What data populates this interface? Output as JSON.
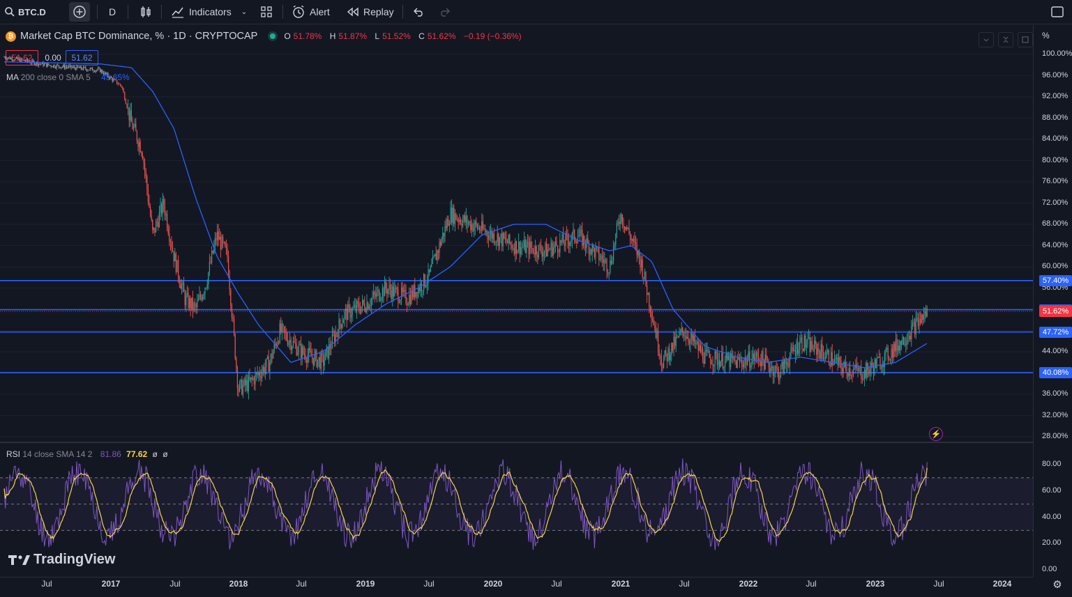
{
  "toolbar": {
    "symbol": "BTC.D",
    "interval": "D",
    "indicators_label": "Indicators",
    "alert_label": "Alert",
    "replay_label": "Replay",
    "icons": [
      "search-icon",
      "add-symbol-icon",
      "candles-icon",
      "indicators-icon",
      "templates-icon",
      "alert-icon",
      "replay-icon",
      "undo-icon",
      "redo-icon",
      "fullscreen-icon"
    ]
  },
  "legend": {
    "title": "Market Cap BTC Dominance, % · 1D · CRYPTOCAP",
    "o_label": "O",
    "o_value": "51.78%",
    "h_label": "H",
    "h_value": "51.87%",
    "l_label": "L",
    "l_value": "51.52%",
    "c_label": "C",
    "c_value": "51.62%",
    "change": "−0.19 (−0.36%)",
    "bid": "51.62",
    "spread": "0.00",
    "ask": "51.62"
  },
  "ma_legend": {
    "name": "MA",
    "params": "200 close 0 SMA 5",
    "value": "45.65%"
  },
  "rsi_legend": {
    "name": "RSI",
    "params": "14 close SMA 14 2",
    "rsi_value": "81.86",
    "ma_value": "77.62",
    "extra1": "ø",
    "extra2": "ø"
  },
  "watermark": "TradingView",
  "price_axis": {
    "unit": "%",
    "ticks": [
      "100.00%",
      "96.00%",
      "92.00%",
      "88.00%",
      "84.00%",
      "80.00%",
      "76.00%",
      "72.00%",
      "68.00%",
      "64.00%",
      "60.00%",
      "56.00%",
      "44.00%",
      "36.00%",
      "32.00%",
      "28.00%"
    ],
    "labels": [
      {
        "text": "57.40%",
        "value": 57.4,
        "color": "#2962ff"
      },
      {
        "text": "51.92%",
        "value": 51.92,
        "color": "#2962ff"
      },
      {
        "text": "51.62%",
        "value": 51.62,
        "color": "#f23645"
      },
      {
        "text": "47.72%",
        "value": 47.72,
        "color": "#2962ff"
      },
      {
        "text": "40.08%",
        "value": 40.08,
        "color": "#2962ff"
      }
    ]
  },
  "rsi_axis": {
    "ticks": [
      "80.00",
      "60.00",
      "40.00",
      "20.00",
      "0.00"
    ]
  },
  "time_axis": [
    {
      "label": "Jul",
      "bold": false
    },
    {
      "label": "2017",
      "bold": true
    },
    {
      "label": "Jul",
      "bold": false
    },
    {
      "label": "2018",
      "bold": true
    },
    {
      "label": "Jul",
      "bold": false
    },
    {
      "label": "2019",
      "bold": true
    },
    {
      "label": "Jul",
      "bold": false
    },
    {
      "label": "2020",
      "bold": true
    },
    {
      "label": "Jul",
      "bold": false
    },
    {
      "label": "2021",
      "bold": true
    },
    {
      "label": "Jul",
      "bold": false
    },
    {
      "label": "2022",
      "bold": true
    },
    {
      "label": "Jul",
      "bold": false
    },
    {
      "label": "2023",
      "bold": true
    },
    {
      "label": "Jul",
      "bold": false
    },
    {
      "label": "2024",
      "bold": true
    }
  ],
  "colors": {
    "up": "#26a69a",
    "down": "#ef5350",
    "ma": "#2962ff",
    "rsi": "#7e57c2",
    "rsi_ma": "#f5d742",
    "hline": "#2962ff"
  },
  "chart_data": {
    "type": "line",
    "title": "Market Cap BTC Dominance, % · 1D · CRYPTOCAP",
    "ylim": [
      26,
      102
    ],
    "horizontal_levels": [
      57.4,
      51.92,
      47.72,
      40.08
    ],
    "series": [
      {
        "name": "BTC.D",
        "x": [
          "2016-03",
          "2016-07",
          "2016-12",
          "2017-02",
          "2017-03",
          "2017-04",
          "2017-05",
          "2017-06",
          "2017-07",
          "2017-08",
          "2017-09",
          "2017-10",
          "2017-11",
          "2017-12",
          "2018-01",
          "2018-02",
          "2018-04",
          "2018-05",
          "2018-07",
          "2018-09",
          "2018-11",
          "2019-01",
          "2019-03",
          "2019-05",
          "2019-07",
          "2019-09",
          "2019-12",
          "2020-03",
          "2020-06",
          "2020-09",
          "2020-11",
          "2020-12",
          "2021-01",
          "2021-03",
          "2021-05",
          "2021-07",
          "2021-09",
          "2021-12",
          "2022-02",
          "2022-04",
          "2022-06",
          "2022-08",
          "2022-10",
          "2022-12",
          "2023-02",
          "2023-04",
          "2023-06"
        ],
        "values": [
          99.5,
          98,
          97,
          94,
          87,
          82,
          66,
          72,
          62,
          54,
          52,
          57,
          66,
          62,
          37,
          38,
          42,
          48,
          44,
          42,
          51,
          53,
          56,
          54,
          58,
          70,
          67,
          64,
          63,
          66,
          62,
          60,
          70,
          61,
          42,
          48,
          43,
          42,
          43,
          40,
          46,
          44,
          41,
          40,
          43,
          47,
          51.6
        ]
      },
      {
        "name": "MA 200",
        "x": [
          "2016-03",
          "2016-12",
          "2017-03",
          "2017-05",
          "2017-07",
          "2017-09",
          "2017-11",
          "2018-01",
          "2018-03",
          "2018-06",
          "2018-09",
          "2018-12",
          "2019-03",
          "2019-06",
          "2019-09",
          "2019-12",
          "2020-03",
          "2020-06",
          "2020-09",
          "2020-12",
          "2021-02",
          "2021-04",
          "2021-06",
          "2021-09",
          "2021-12",
          "2022-03",
          "2022-06",
          "2022-09",
          "2022-12",
          "2023-03",
          "2023-06"
        ],
        "values": [
          98.6,
          98.2,
          97.5,
          93,
          86,
          73,
          62,
          55,
          49,
          42,
          44,
          49,
          53,
          56,
          60,
          66,
          68,
          68,
          65,
          63,
          64,
          61,
          52,
          45,
          43,
          42,
          43,
          42,
          41,
          42,
          45.65
        ]
      }
    ],
    "rsi": {
      "ylim": [
        0,
        100
      ],
      "bands": [
        70,
        50,
        30
      ],
      "last": 81.86,
      "ma_last": 77.62
    }
  }
}
